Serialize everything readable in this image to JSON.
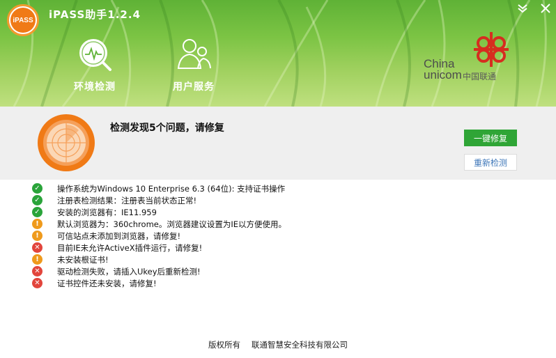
{
  "header": {
    "app_title": "iPASS助手1.2.4",
    "logo_text": "iPASS",
    "brand_color": "#5fb236",
    "nav": [
      {
        "label": "环境检测",
        "icon": "monitor-magnifier-icon"
      },
      {
        "label": "用户服务",
        "icon": "users-icon"
      }
    ],
    "window_controls": {
      "minimize": "chevron-down-icon",
      "close": "close-icon"
    },
    "partner": {
      "en_line1": "China",
      "en_line2": "unicom",
      "cn": "中国联通"
    }
  },
  "status": {
    "title": "检测发现5个问题，请修复",
    "fix_button": "一键修复",
    "recheck_button": "重新检测",
    "accent_color": "#f07a16"
  },
  "results": [
    {
      "status": "ok",
      "text": "操作系统为Windows 10 Enterprise 6.3 (64位): 支持证书操作"
    },
    {
      "status": "ok",
      "text": "注册表检测结果：注册表当前状态正常!"
    },
    {
      "status": "ok",
      "text": "安装的浏览器有：IE11.959"
    },
    {
      "status": "warn",
      "text": "默认浏览器为：360chrome。浏览器建议设置为IE以方便使用。"
    },
    {
      "status": "warn",
      "text": "可信站点未添加到浏览器，请修复!"
    },
    {
      "status": "err",
      "text": "目前IE未允许ActiveX插件运行，请修复!"
    },
    {
      "status": "warn",
      "text": "未安装根证书!"
    },
    {
      "status": "err",
      "text": "驱动检测失败，请插入Ukey后重新检测!"
    },
    {
      "status": "err",
      "text": "证书控件还未安装，请修复!"
    }
  ],
  "footer": {
    "copyright": "版权所有",
    "company": "联通智慧安全科技有限公司"
  }
}
